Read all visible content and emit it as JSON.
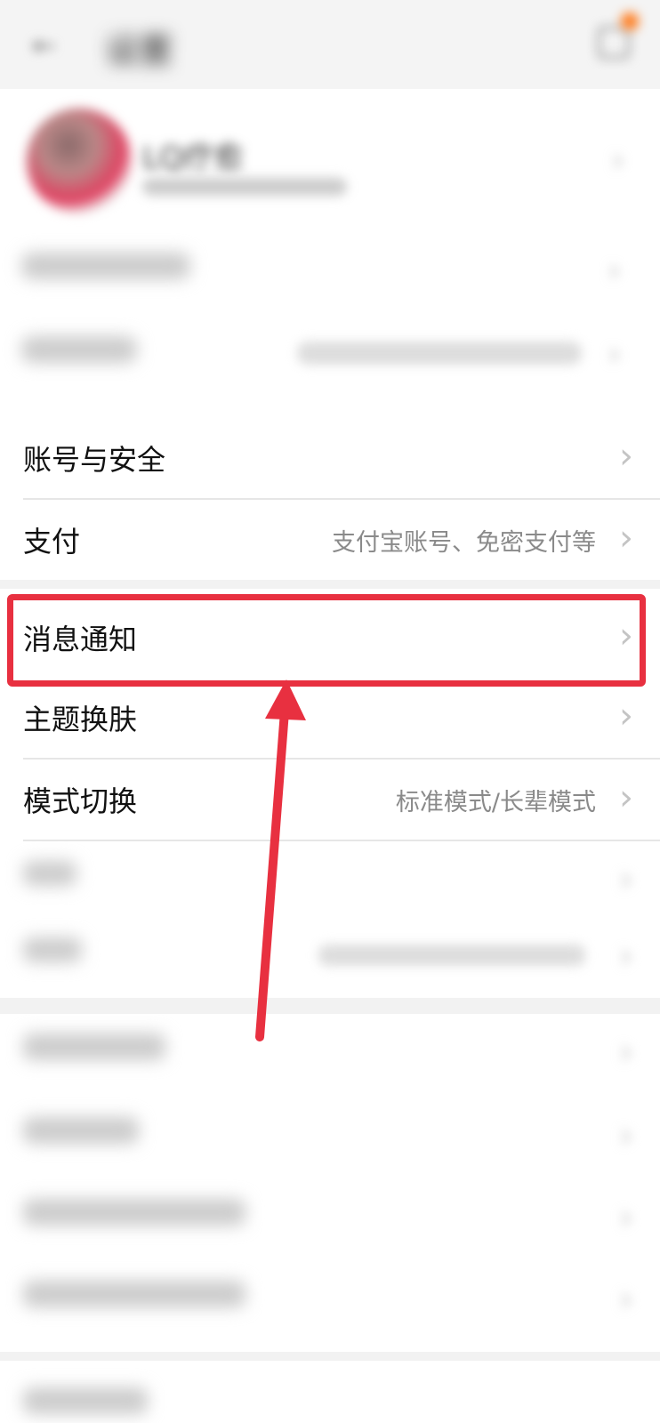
{
  "header": {
    "title": "设置"
  },
  "profile": {
    "nickname": "LQ疗愈"
  },
  "sections": [
    {
      "rows": [
        {
          "label": "账号与安全",
          "value": ""
        },
        {
          "label": "支付",
          "value": "支付宝账号、免密支付等"
        }
      ]
    },
    {
      "rows": [
        {
          "label": "消息通知",
          "value": ""
        },
        {
          "label": "主题换肤",
          "value": ""
        },
        {
          "label": "模式切换",
          "value": "标准模式/长辈模式"
        }
      ]
    }
  ],
  "colors": {
    "highlight": "#e83040",
    "background": "#f2f2f2",
    "notification_dot": "#ff7a1a"
  }
}
